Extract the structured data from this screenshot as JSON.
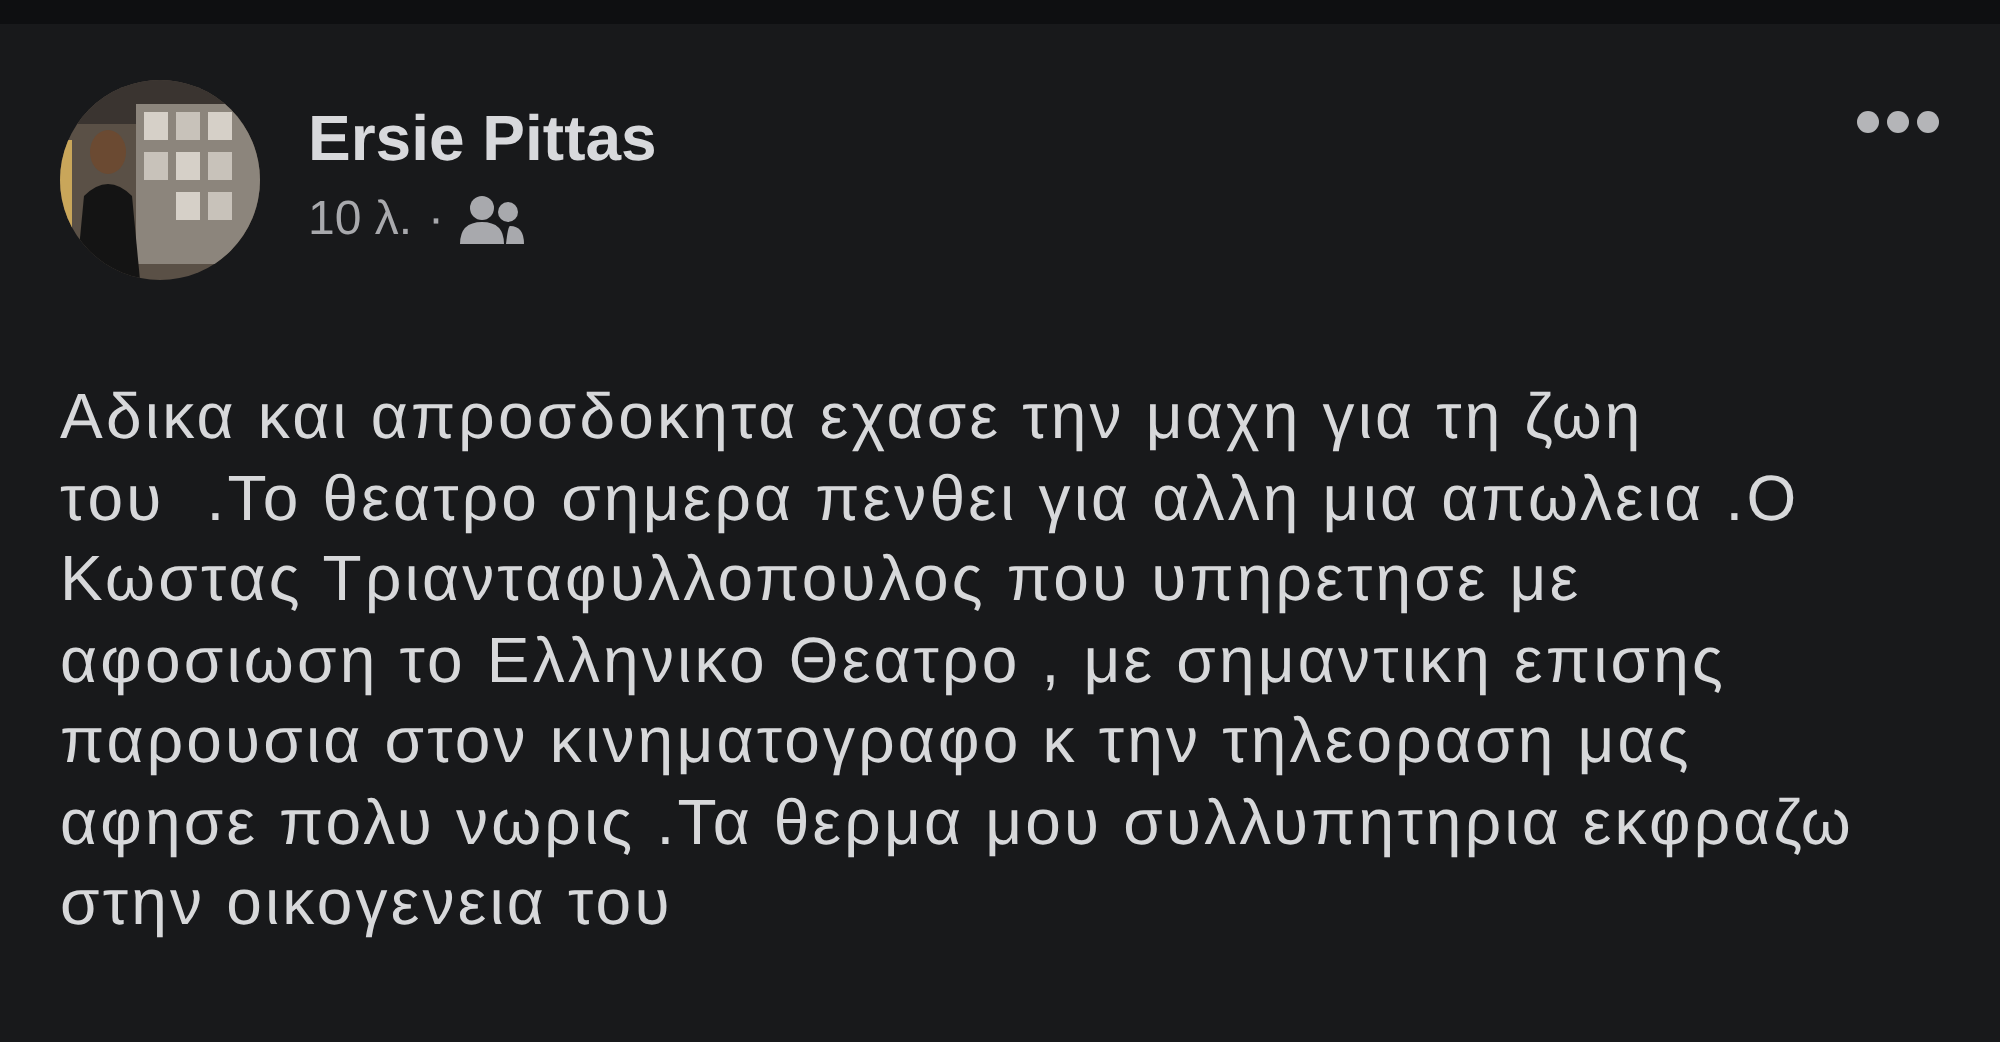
{
  "post": {
    "author": "Ersie Pittas",
    "time": "10 λ.",
    "separator": "·",
    "text": "Αδικα και απροσδοκητα εχασε την μαχη για τη ζωη\nτου  .Το θεατρο σημερα πενθει για αλλη μια απωλεια .Ο\nΚωστας Τριανταφυλλοπουλος που υπηρετησε με\nαφοσιωση το Ελληνικο Θεατρο , με σημαντικη επισης\nπαρουσια στον κινηματογραφο κ την τηλεοραση μας\nαφησε πολυ νωρις .Τα θερμα μου συλλυπητηρια εκφραζω\nστην οικογενεια του"
  }
}
